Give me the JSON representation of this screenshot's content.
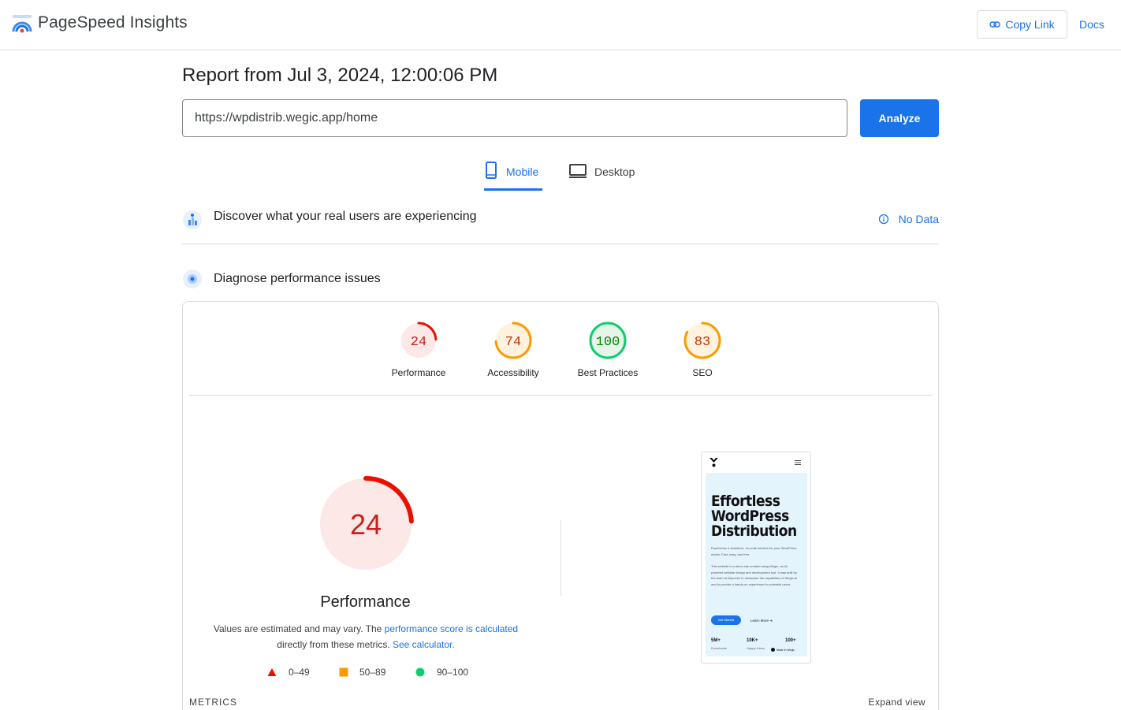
{
  "header": {
    "brand": "PageSpeed Insights",
    "copy_link_label": "Copy Link",
    "docs_label": "Docs"
  },
  "report": {
    "title": "Report from Jul 3, 2024, 12:00:06 PM",
    "url_value": "https://wpdistrib.wegic.app/home",
    "analyze_label": "Analyze"
  },
  "tabs": [
    {
      "label": "Mobile",
      "active": true
    },
    {
      "label": "Desktop",
      "active": false
    }
  ],
  "sections": {
    "crux_title": "Discover what your real users are experiencing",
    "no_data_label": "No Data",
    "diagnose_title": "Diagnose performance issues"
  },
  "scores": [
    {
      "label": "Performance",
      "value": 24,
      "color": "#eb0f00",
      "bg": "#fce8e6"
    },
    {
      "label": "Accessibility",
      "value": 74,
      "color": "#fa9b00",
      "bg": "#fff3e0"
    },
    {
      "label": "Best Practices",
      "value": 100,
      "color": "#0cce6b",
      "bg": "#e6f4ea"
    },
    {
      "label": "SEO",
      "value": 83,
      "color": "#fa9b00",
      "bg": "#fff3e0"
    }
  ],
  "performance": {
    "value": "24",
    "title": "Performance",
    "note_part1": "Values are estimated and may vary. The ",
    "note_link1": "performance score is calculated",
    "note_part2": " directly from these metrics. ",
    "note_link2": "See calculator."
  },
  "legend": [
    {
      "label": "0–49",
      "shape": "triangle",
      "color": "#eb0f00"
    },
    {
      "label": "50–89",
      "shape": "square",
      "color": "#fa9b00"
    },
    {
      "label": "90–100",
      "shape": "circle",
      "color": "#0cce6b"
    }
  ],
  "metrics": {
    "label": "METRICS",
    "expand_label": "Expand view"
  },
  "screenshot": {
    "title_line1": "Effortless",
    "title_line2": "WordPress",
    "title_line3": "Distribution",
    "subtitle": "Experience a seamless, no-code solution for your WordPress needs. Fast, easy, and free.",
    "body": "This website is a demo site created using Wegic, an AI-powered website design and development tool. It was built by the team at Wpcoder to showcase the capabilities of Wegic.ai and to provide a hands-on experience for potential users.",
    "cta": "Get Started",
    "learn": "Learn More ➔",
    "stats": [
      {
        "value": "5M+",
        "label": "Downloads"
      },
      {
        "value": "10K+",
        "label": "Happy Users"
      },
      {
        "value": "100+",
        "label": ""
      }
    ],
    "made_with": "Made in Wegic"
  }
}
